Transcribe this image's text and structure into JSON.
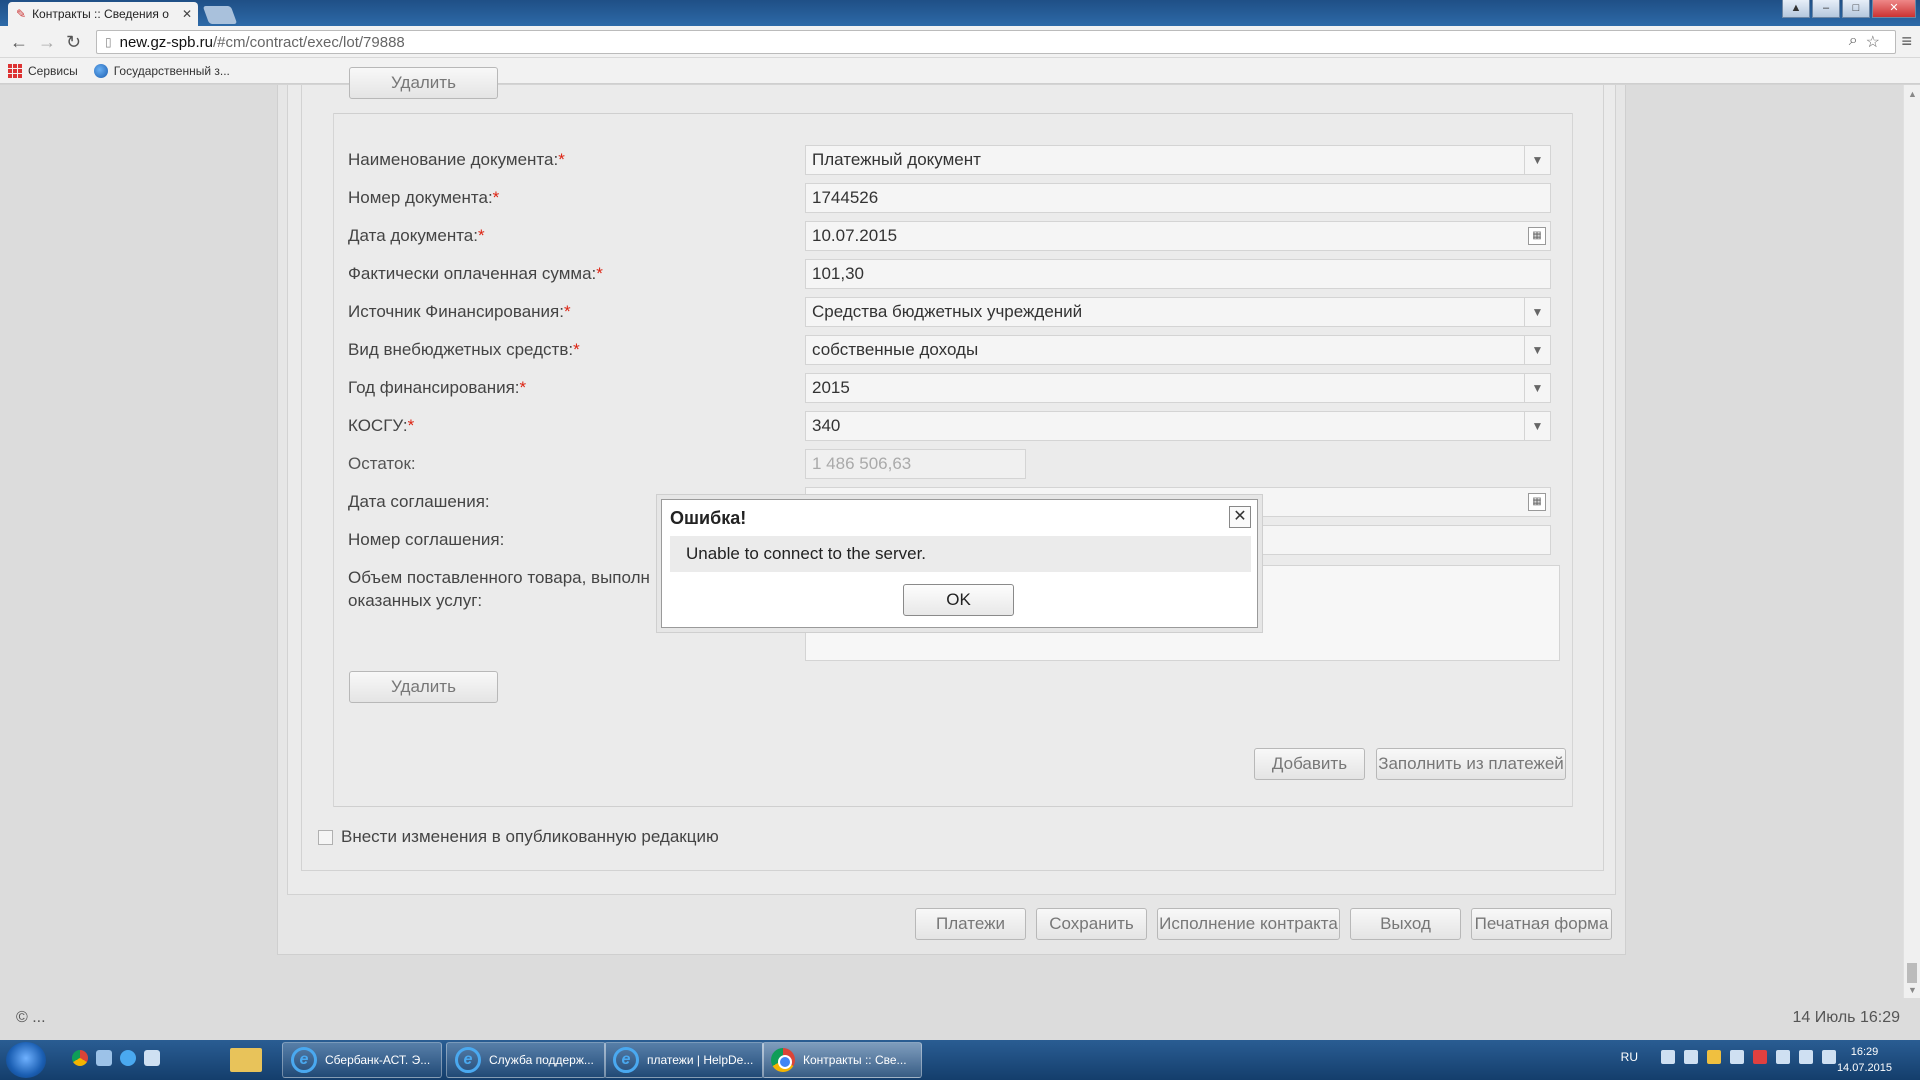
{
  "browser": {
    "tab_title": "Контракты :: Сведения о",
    "url_host": "new.gz-spb.ru",
    "url_path": "/#cm/contract/exec/lot/79888",
    "bookmarks": [
      "Сервисы",
      "Государственный з..."
    ]
  },
  "form": {
    "top_delete_label": "Удалить",
    "fields": [
      {
        "label": "Наименование документа:",
        "value": "Платежный документ"
      },
      {
        "label": "Номер документа:",
        "value": "1744526"
      },
      {
        "label": "Дата документа:",
        "value": "10.07.2015"
      },
      {
        "label": "Фактически оплаченная сумма:",
        "value": "101,30"
      },
      {
        "label": "Источник Финансирования:",
        "value": "Средства бюджетных учреждений"
      },
      {
        "label": "Вид внебюджетных средств:",
        "value": "собственные доходы"
      },
      {
        "label": "Год финансирования:",
        "value": "2015"
      },
      {
        "label": "КОСГУ:",
        "value": "340"
      },
      {
        "label": "Остаток:",
        "value": "1 486 506,63"
      },
      {
        "label": "Дата соглашения:",
        "value": ""
      },
      {
        "label": "Номер соглашения:",
        "value": ""
      },
      {
        "label_line1": "Объем поставленного товара, выполн",
        "label_line2": "оказанных услуг:"
      }
    ],
    "required_mark": "*",
    "delete_label": "Удалить",
    "add_label": "Добавить",
    "fill_label": "Заполнить из платежей",
    "checkbox_label": "Внести изменения в опубликованную редакцию"
  },
  "bottom_buttons": [
    "Платежи",
    "Сохранить",
    "Исполнение контракта",
    "Выход",
    "Печатная форма"
  ],
  "footer": {
    "copyright": "© ...",
    "datetime": "14 Июль 16:29"
  },
  "dialog": {
    "title": "Ошибка!",
    "message": "Unable to connect to the server.",
    "ok_label": "OK"
  },
  "taskbar": {
    "items": [
      "Сбербанк-АСТ. Э...",
      "Служба поддерж...",
      "платежи | HelpDe...",
      "Контракты :: Све..."
    ],
    "lang": "RU",
    "clock_time": "16:29",
    "clock_date": "14.07.2015"
  }
}
